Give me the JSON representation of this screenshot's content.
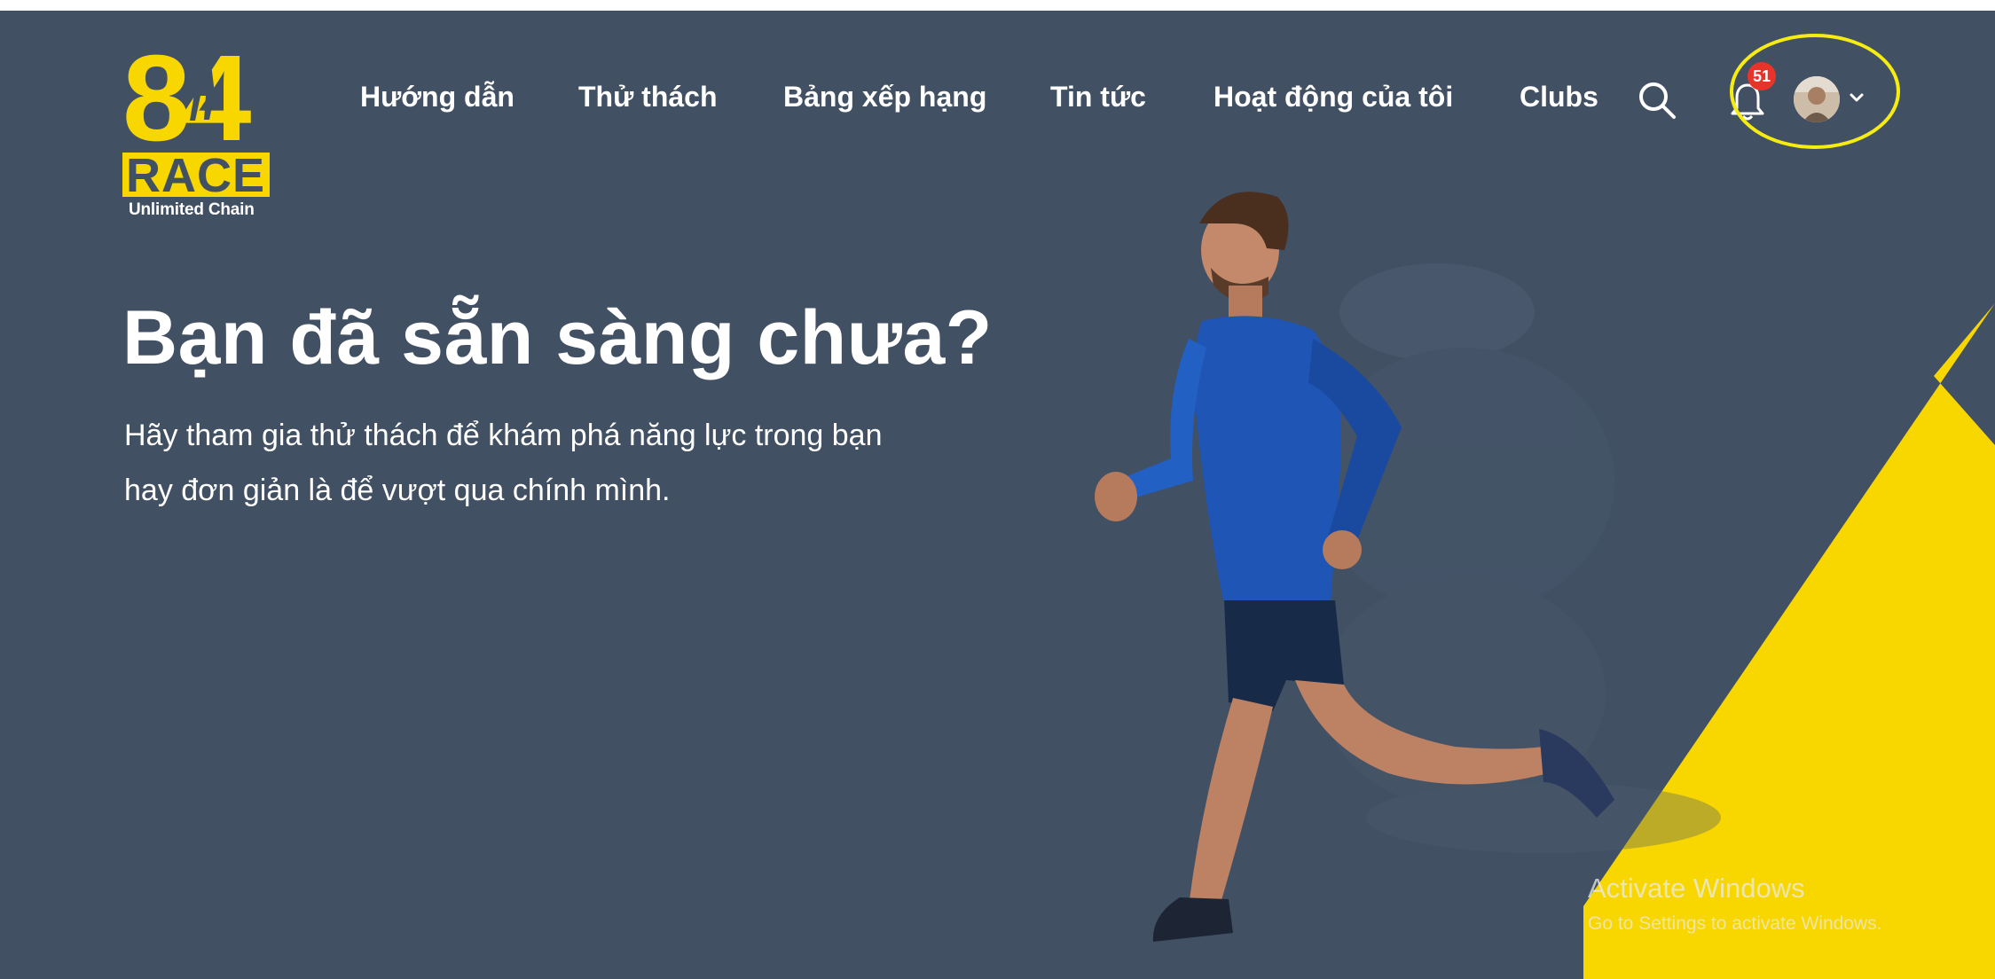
{
  "brand": {
    "logo_number": "84",
    "logo_word": "RACE",
    "tagline": "Unlimited Chain",
    "accent_color": "#f8d600",
    "background_color": "#415063"
  },
  "nav": {
    "items": [
      {
        "label": "Hướng dẫn"
      },
      {
        "label": "Thử thách"
      },
      {
        "label": "Bảng xếp hạng"
      },
      {
        "label": "Tin tức"
      },
      {
        "label": "Hoạt động của tôi"
      },
      {
        "label": "Clubs"
      }
    ],
    "search_icon": "search-icon",
    "notification_icon": "bell-icon",
    "notification_count": "51",
    "avatar_icon": "user-avatar",
    "dropdown_icon": "chevron-down-icon"
  },
  "hero": {
    "title": "Bạn đã sẵn sàng chưa?",
    "subtitle_line1": "Hãy tham gia thử thách để khám phá năng lực trong bạn",
    "subtitle_line2": "hay đơn giản là để vượt qua chính mình."
  },
  "watermark": {
    "line1": "Activate Windows",
    "line2": "Go to Settings to activate Windows."
  }
}
